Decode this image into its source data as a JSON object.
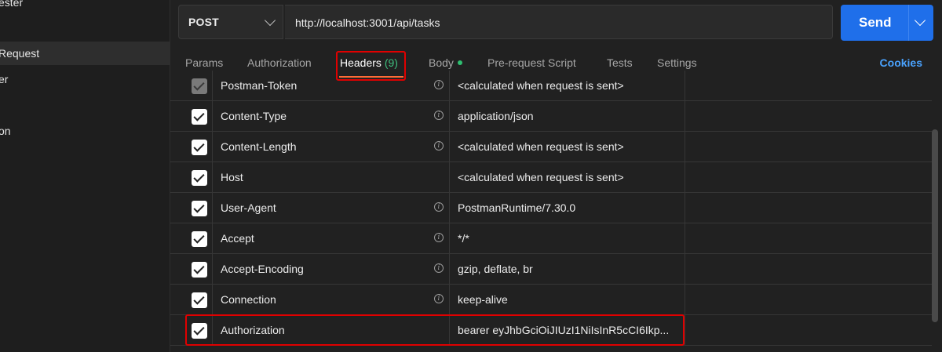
{
  "sidebar": {
    "items": [
      {
        "label": "ester",
        "active": false
      },
      {
        "label": "Request",
        "active": true
      },
      {
        "label": "er",
        "active": false
      },
      {
        "label": "on",
        "active": false
      }
    ]
  },
  "request": {
    "method": "POST",
    "url": "http://localhost:3001/api/tasks",
    "send_label": "Send"
  },
  "tabs": [
    {
      "label": "Params"
    },
    {
      "label": "Authorization"
    },
    {
      "label": "Headers",
      "count": "(9)",
      "active": true
    },
    {
      "label": "Body",
      "dot": true
    },
    {
      "label": "Pre-request Script"
    },
    {
      "label": "Tests"
    },
    {
      "label": "Settings"
    }
  ],
  "cookies_label": "Cookies",
  "headers": [
    {
      "key": "Postman-Token",
      "value": "<calculated when request is sent>",
      "checked": true,
      "disabled": true
    },
    {
      "key": "Content-Type",
      "value": "application/json",
      "checked": true
    },
    {
      "key": "Content-Length",
      "value": "<calculated when request is sent>",
      "checked": true
    },
    {
      "key": "Host",
      "value": "<calculated when request is sent>",
      "checked": true
    },
    {
      "key": "User-Agent",
      "value": "PostmanRuntime/7.30.0",
      "checked": true
    },
    {
      "key": "Accept",
      "value": "*/*",
      "checked": true
    },
    {
      "key": "Accept-Encoding",
      "value": "gzip, deflate, br",
      "checked": true
    },
    {
      "key": "Connection",
      "value": "keep-alive",
      "checked": true
    },
    {
      "key": "Authorization",
      "value": "bearer eyJhbGciOiJIUzI1NiIsInR5cCI6Ikp...",
      "checked": true,
      "custom": true
    }
  ],
  "colors": {
    "accent": "#1f6fea",
    "link": "#4aa3ff",
    "tab_underline": "#ff6c37",
    "highlight": "#e00000",
    "count": "#3fbf7f"
  }
}
